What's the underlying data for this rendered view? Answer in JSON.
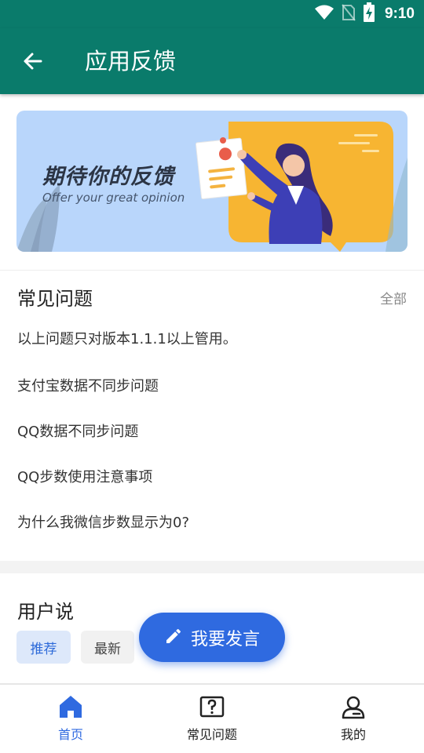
{
  "status_bar": {
    "time": "9:10"
  },
  "app_bar": {
    "title": "应用反馈"
  },
  "banner": {
    "title": "期待你的反馈",
    "subtitle": "Offer your great opinion"
  },
  "faq": {
    "title": "常见问题",
    "all_label": "全部",
    "items": [
      "以上问题只对版本1.1.1以上管用。",
      "支付宝数据不同步问题",
      "QQ数据不同步问题",
      "QQ步数使用注意事项",
      "为什么我微信步数显示为0?"
    ]
  },
  "user_says": {
    "title": "用户说",
    "tabs": [
      "推荐",
      "最新"
    ]
  },
  "fab": {
    "label": "我要发言"
  },
  "bottom_nav": {
    "items": [
      {
        "label": "首页",
        "icon": "home-icon"
      },
      {
        "label": "常见问题",
        "icon": "question-icon"
      },
      {
        "label": "我的",
        "icon": "person-icon"
      }
    ]
  },
  "colors": {
    "primary": "#0a7b6b",
    "accent": "#2f6ae0",
    "active_tab": "#2d6ad9"
  }
}
